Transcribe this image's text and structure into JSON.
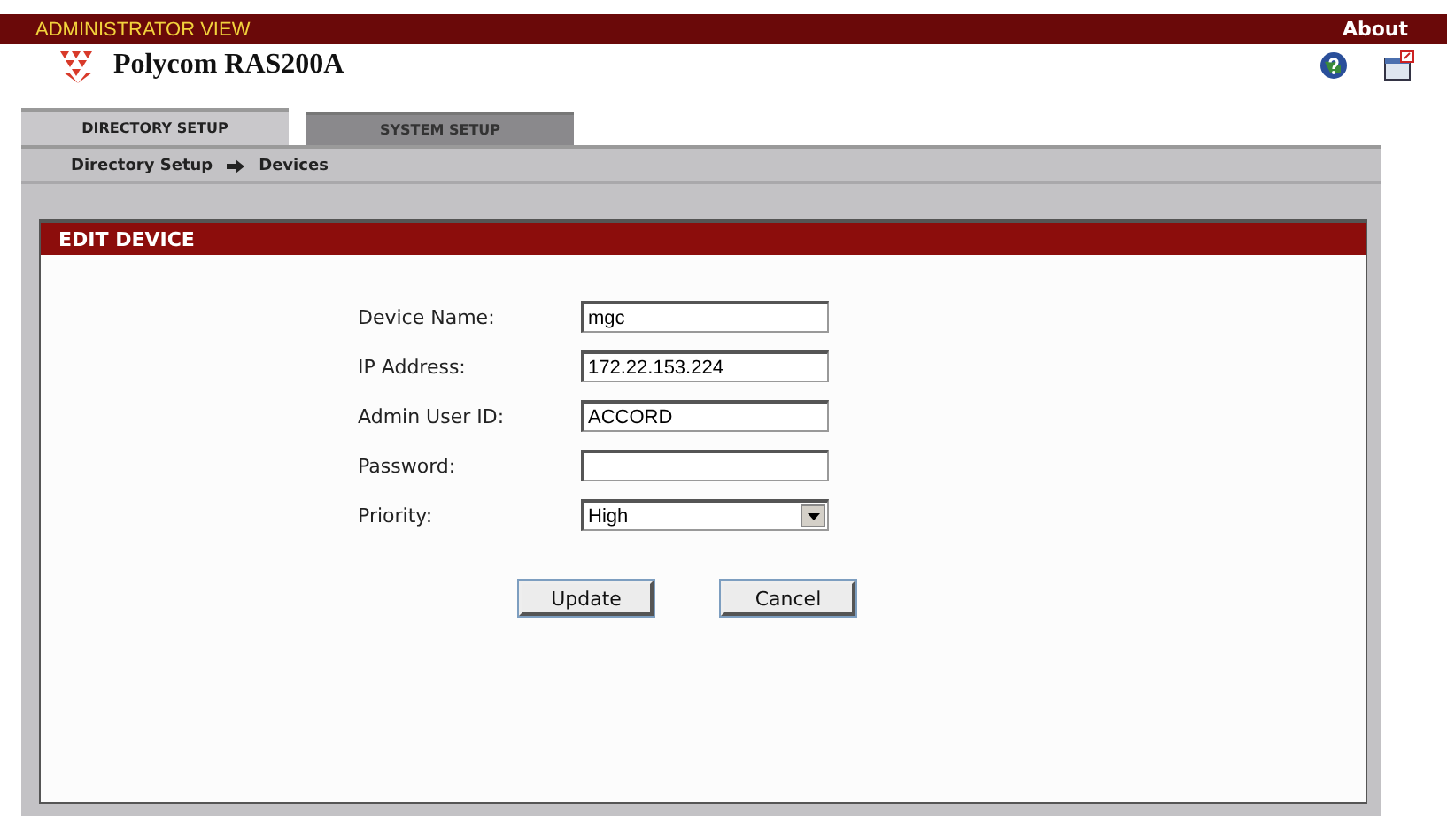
{
  "top_bar": {
    "title": "ADMINISTRATOR VIEW",
    "about": "About"
  },
  "product": {
    "name": "Polycom RAS200A"
  },
  "tabs": [
    {
      "label": "DIRECTORY SETUP",
      "selected": true
    },
    {
      "label": "SYSTEM SETUP",
      "selected": false
    }
  ],
  "breadcrumb": [
    "Directory Setup",
    "Devices"
  ],
  "panel": {
    "title": "EDIT DEVICE",
    "fields": [
      {
        "label": "Device Name:",
        "kind": "text",
        "value": "mgc"
      },
      {
        "label": "IP Address:",
        "kind": "text",
        "value": "172.22.153.224"
      },
      {
        "label": "Admin User ID:",
        "kind": "text",
        "value": "ACCORD"
      },
      {
        "label": "Password:",
        "kind": "password"
      },
      {
        "label": "Priority:",
        "kind": "select",
        "value": "High"
      }
    ],
    "buttons": [
      "Update",
      "Cancel"
    ]
  }
}
